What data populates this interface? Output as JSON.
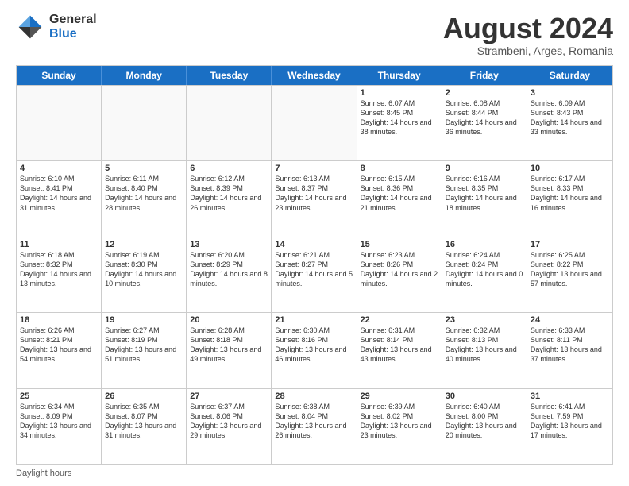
{
  "logo": {
    "general": "General",
    "blue": "Blue"
  },
  "title": "August 2024",
  "location": "Strambeni, Arges, Romania",
  "footer": "Daylight hours",
  "days_of_week": [
    "Sunday",
    "Monday",
    "Tuesday",
    "Wednesday",
    "Thursday",
    "Friday",
    "Saturday"
  ],
  "weeks": [
    [
      {
        "day": "",
        "info": ""
      },
      {
        "day": "",
        "info": ""
      },
      {
        "day": "",
        "info": ""
      },
      {
        "day": "",
        "info": ""
      },
      {
        "day": "1",
        "info": "Sunrise: 6:07 AM\nSunset: 8:45 PM\nDaylight: 14 hours and 38 minutes."
      },
      {
        "day": "2",
        "info": "Sunrise: 6:08 AM\nSunset: 8:44 PM\nDaylight: 14 hours and 36 minutes."
      },
      {
        "day": "3",
        "info": "Sunrise: 6:09 AM\nSunset: 8:43 PM\nDaylight: 14 hours and 33 minutes."
      }
    ],
    [
      {
        "day": "4",
        "info": "Sunrise: 6:10 AM\nSunset: 8:41 PM\nDaylight: 14 hours and 31 minutes."
      },
      {
        "day": "5",
        "info": "Sunrise: 6:11 AM\nSunset: 8:40 PM\nDaylight: 14 hours and 28 minutes."
      },
      {
        "day": "6",
        "info": "Sunrise: 6:12 AM\nSunset: 8:39 PM\nDaylight: 14 hours and 26 minutes."
      },
      {
        "day": "7",
        "info": "Sunrise: 6:13 AM\nSunset: 8:37 PM\nDaylight: 14 hours and 23 minutes."
      },
      {
        "day": "8",
        "info": "Sunrise: 6:15 AM\nSunset: 8:36 PM\nDaylight: 14 hours and 21 minutes."
      },
      {
        "day": "9",
        "info": "Sunrise: 6:16 AM\nSunset: 8:35 PM\nDaylight: 14 hours and 18 minutes."
      },
      {
        "day": "10",
        "info": "Sunrise: 6:17 AM\nSunset: 8:33 PM\nDaylight: 14 hours and 16 minutes."
      }
    ],
    [
      {
        "day": "11",
        "info": "Sunrise: 6:18 AM\nSunset: 8:32 PM\nDaylight: 14 hours and 13 minutes."
      },
      {
        "day": "12",
        "info": "Sunrise: 6:19 AM\nSunset: 8:30 PM\nDaylight: 14 hours and 10 minutes."
      },
      {
        "day": "13",
        "info": "Sunrise: 6:20 AM\nSunset: 8:29 PM\nDaylight: 14 hours and 8 minutes."
      },
      {
        "day": "14",
        "info": "Sunrise: 6:21 AM\nSunset: 8:27 PM\nDaylight: 14 hours and 5 minutes."
      },
      {
        "day": "15",
        "info": "Sunrise: 6:23 AM\nSunset: 8:26 PM\nDaylight: 14 hours and 2 minutes."
      },
      {
        "day": "16",
        "info": "Sunrise: 6:24 AM\nSunset: 8:24 PM\nDaylight: 14 hours and 0 minutes."
      },
      {
        "day": "17",
        "info": "Sunrise: 6:25 AM\nSunset: 8:22 PM\nDaylight: 13 hours and 57 minutes."
      }
    ],
    [
      {
        "day": "18",
        "info": "Sunrise: 6:26 AM\nSunset: 8:21 PM\nDaylight: 13 hours and 54 minutes."
      },
      {
        "day": "19",
        "info": "Sunrise: 6:27 AM\nSunset: 8:19 PM\nDaylight: 13 hours and 51 minutes."
      },
      {
        "day": "20",
        "info": "Sunrise: 6:28 AM\nSunset: 8:18 PM\nDaylight: 13 hours and 49 minutes."
      },
      {
        "day": "21",
        "info": "Sunrise: 6:30 AM\nSunset: 8:16 PM\nDaylight: 13 hours and 46 minutes."
      },
      {
        "day": "22",
        "info": "Sunrise: 6:31 AM\nSunset: 8:14 PM\nDaylight: 13 hours and 43 minutes."
      },
      {
        "day": "23",
        "info": "Sunrise: 6:32 AM\nSunset: 8:13 PM\nDaylight: 13 hours and 40 minutes."
      },
      {
        "day": "24",
        "info": "Sunrise: 6:33 AM\nSunset: 8:11 PM\nDaylight: 13 hours and 37 minutes."
      }
    ],
    [
      {
        "day": "25",
        "info": "Sunrise: 6:34 AM\nSunset: 8:09 PM\nDaylight: 13 hours and 34 minutes."
      },
      {
        "day": "26",
        "info": "Sunrise: 6:35 AM\nSunset: 8:07 PM\nDaylight: 13 hours and 31 minutes."
      },
      {
        "day": "27",
        "info": "Sunrise: 6:37 AM\nSunset: 8:06 PM\nDaylight: 13 hours and 29 minutes."
      },
      {
        "day": "28",
        "info": "Sunrise: 6:38 AM\nSunset: 8:04 PM\nDaylight: 13 hours and 26 minutes."
      },
      {
        "day": "29",
        "info": "Sunrise: 6:39 AM\nSunset: 8:02 PM\nDaylight: 13 hours and 23 minutes."
      },
      {
        "day": "30",
        "info": "Sunrise: 6:40 AM\nSunset: 8:00 PM\nDaylight: 13 hours and 20 minutes."
      },
      {
        "day": "31",
        "info": "Sunrise: 6:41 AM\nSunset: 7:59 PM\nDaylight: 13 hours and 17 minutes."
      }
    ]
  ]
}
